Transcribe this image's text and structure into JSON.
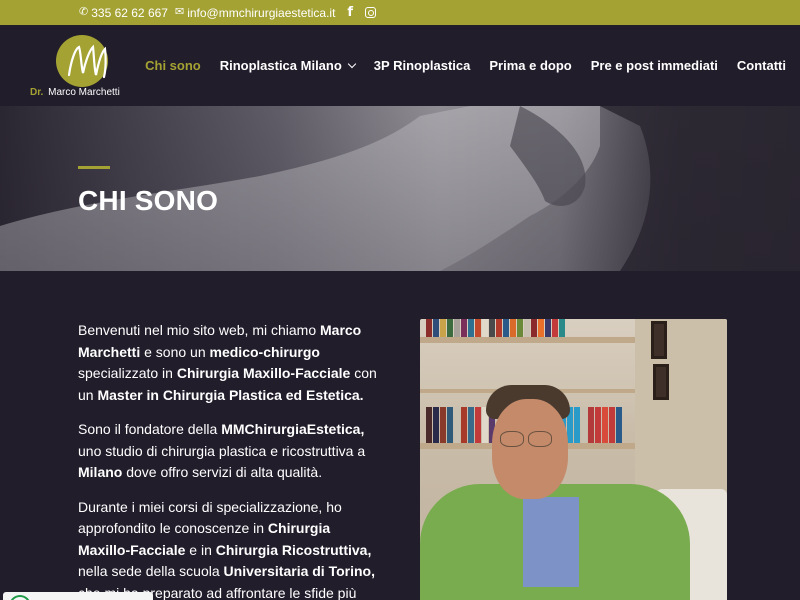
{
  "topbar": {
    "phone": "335 62 62 667",
    "email": "info@mmchirurgiaestetica.it",
    "phone_icon": "phone-icon",
    "email_icon": "envelope-icon",
    "facebook_icon": "facebook-icon",
    "instagram_icon": "instagram-icon"
  },
  "logo": {
    "prefix": "Dr.",
    "name": "Marco Marchetti"
  },
  "nav": {
    "items": [
      {
        "label": "Chi sono",
        "active": true
      },
      {
        "label": "Rinoplastica Milano",
        "dropdown": true
      },
      {
        "label": "3P Rinoplastica"
      },
      {
        "label": "Prima e dopo"
      },
      {
        "label": "Pre e post immediati"
      },
      {
        "label": "Contatti"
      }
    ]
  },
  "hero": {
    "title": "CHI SONO"
  },
  "content": {
    "p1": {
      "a": "Benvenuti nel mio sito web, mi chiamo ",
      "b": "Marco Marchetti",
      "c": " e sono un ",
      "d": "medico-chirurgo",
      "e": " specializzato in ",
      "f": "Chirurgia Maxillo-Facciale",
      "g": " con un ",
      "h": "Master in Chirurgia Plastica ed Estetica."
    },
    "p2": {
      "a": "Sono il fondatore della ",
      "b": "MMChirurgiaEstetica,",
      "c": " uno studio di chirurgia plastica e ricostruttiva a ",
      "d": "Milano",
      "e": " dove offro servizi di alta qualità."
    },
    "p3": {
      "a": "Durante i miei corsi di specializzazione, ho approfondito le conoscenze in ",
      "b": "Chirurgia Maxillo-Facciale",
      "c": " e in ",
      "d": "Chirurgia Ricostruttiva,",
      "e": " nella sede della scuola ",
      "f": "Universitaria di Torino,",
      "g": " che mi ha preparato ad affrontare le sfide più"
    }
  },
  "colors": {
    "accent": "#a4a233",
    "background": "#221d2b",
    "text": "#ffffff"
  }
}
